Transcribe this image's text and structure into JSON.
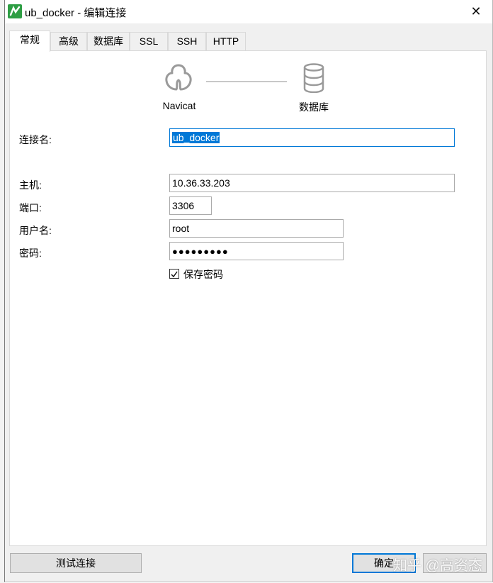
{
  "window": {
    "title": "ub_docker - 编辑连接",
    "close_glyph": "✕"
  },
  "tabs": [
    {
      "label": "常规",
      "active": true
    },
    {
      "label": "高级",
      "active": false
    },
    {
      "label": "数据库",
      "active": false
    },
    {
      "label": "SSL",
      "active": false
    },
    {
      "label": "SSH",
      "active": false
    },
    {
      "label": "HTTP",
      "active": false
    }
  ],
  "header": {
    "left_icon": "navicat-logo-icon",
    "left_label": "Navicat",
    "right_icon": "database-icon",
    "right_label": "数据库"
  },
  "form": {
    "conn_name": {
      "label": "连接名:",
      "value": "ub_docker"
    },
    "host": {
      "label": "主机:",
      "value": "10.36.33.203"
    },
    "port": {
      "label": "端口:",
      "value": "3306"
    },
    "user": {
      "label": "用户名:",
      "value": "root"
    },
    "password": {
      "label": "密码:",
      "value": "●●●●●●●●●"
    },
    "save_password": {
      "label": "保存密码",
      "checked": true,
      "glyph": "✓"
    }
  },
  "buttons": {
    "test": "测试连接",
    "ok": "确定"
  },
  "watermark": "知乎 @高资态",
  "colors": {
    "accent": "#0078d7",
    "app_icon": "#2e9e44"
  }
}
